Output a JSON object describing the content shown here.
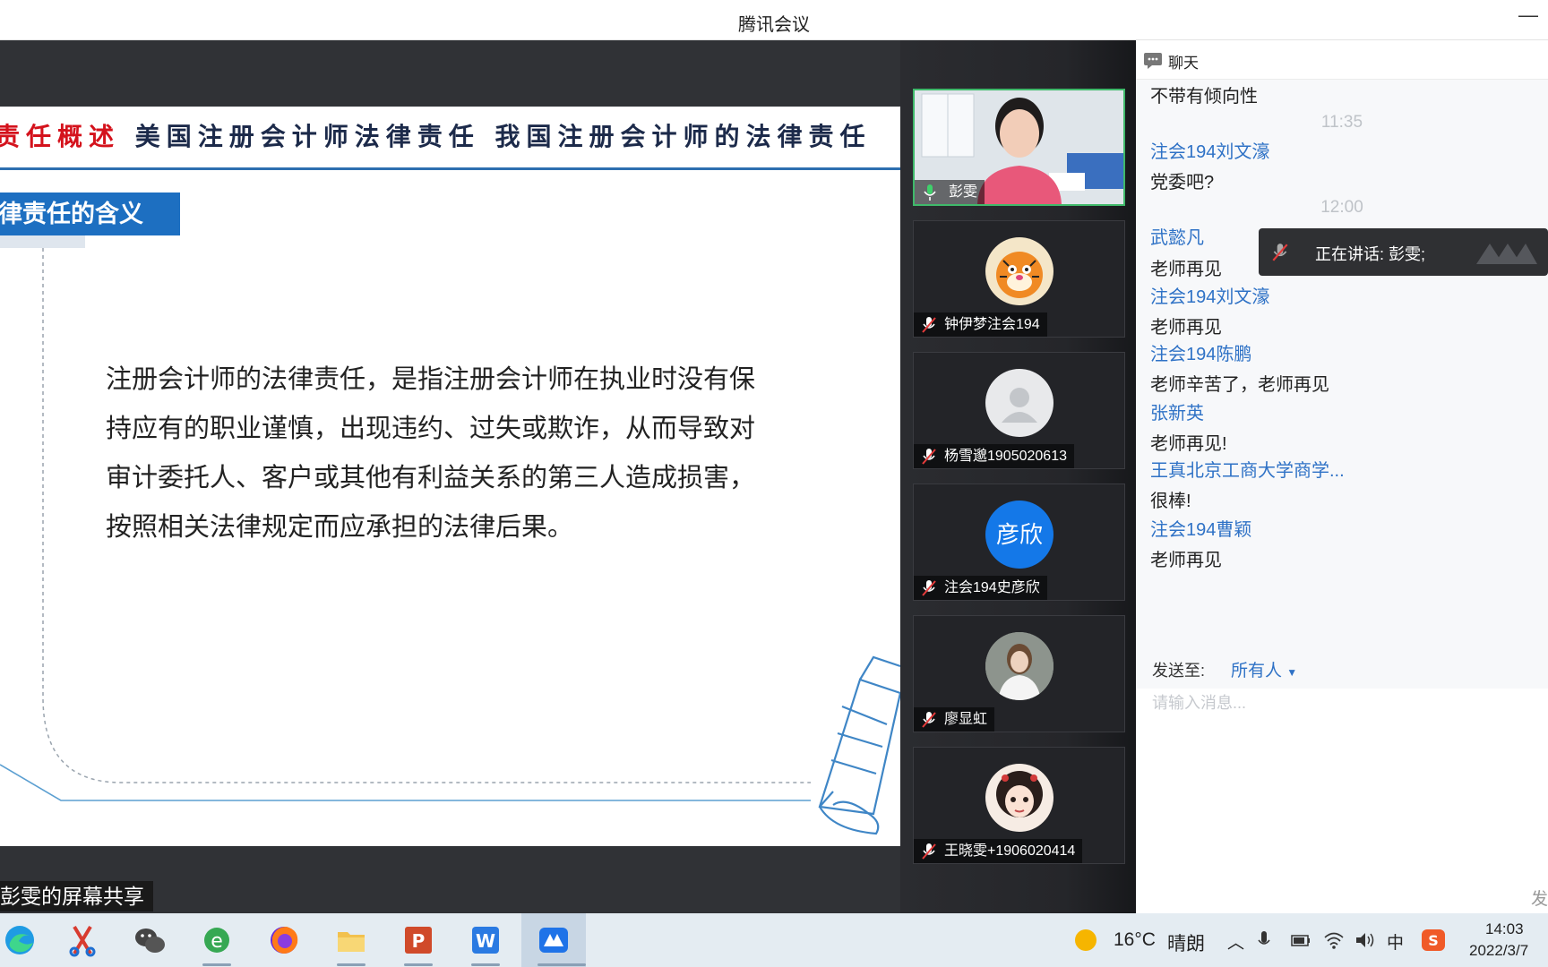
{
  "window": {
    "title": "腾讯会议"
  },
  "slide": {
    "nav_red": "责任概述",
    "nav_rest": "美国注册会计师法律责任 我国注册会计师的法律责任",
    "section_title": "律责任的含义",
    "body_lines": [
      "注册会计师的法律责任，是指注册会计师在执业时没有保",
      "持应有的职业谨慎，出现违约、过失或欺诈，从而导致对",
      "审计委托人、客户或其他有利益关系的第三人造成损害，",
      "按照相关法律规定而应承担的法律后果。"
    ]
  },
  "share_label": "彭雯的屏幕共享",
  "participants": [
    {
      "name": "彭雯",
      "muted": false,
      "avatar": "video",
      "active": true
    },
    {
      "name": "钟伊梦注会194",
      "muted": true,
      "avatar": "tiger"
    },
    {
      "name": "杨雪邈1905020613",
      "muted": true,
      "avatar": "default"
    },
    {
      "name": "注会194史彦欣",
      "muted": true,
      "avatar": "text",
      "avatar_text": "彦欣"
    },
    {
      "name": "廖显虹",
      "muted": true,
      "avatar": "photo"
    },
    {
      "name": "王晓雯+1906020414",
      "muted": true,
      "avatar": "cartoon"
    }
  ],
  "chat": {
    "title": "聊天",
    "messages": [
      {
        "kind": "text",
        "value": "不带有倾向性"
      },
      {
        "kind": "time",
        "value": "11:35"
      },
      {
        "kind": "sender",
        "value": "注会194刘文濠"
      },
      {
        "kind": "text",
        "value": "党委吧?"
      },
      {
        "kind": "time",
        "value": "12:00"
      },
      {
        "kind": "sender",
        "value": "武懿凡"
      },
      {
        "kind": "text",
        "value": "老师再见"
      },
      {
        "kind": "sender",
        "value": "注会194刘文濠"
      },
      {
        "kind": "text",
        "value": "老师再见"
      },
      {
        "kind": "sender",
        "value": "注会194陈鹏"
      },
      {
        "kind": "text",
        "value": "老师辛苦了，老师再见"
      },
      {
        "kind": "sender",
        "value": "张新英"
      },
      {
        "kind": "text",
        "value": "老师再见!"
      },
      {
        "kind": "sender",
        "value": "王真北京工商大学商学..."
      },
      {
        "kind": "text",
        "value": "很棒!"
      },
      {
        "kind": "sender",
        "value": "注会194曹颖"
      },
      {
        "kind": "text",
        "value": "老师再见"
      }
    ],
    "speaking_label": "正在讲话: 彭雯;",
    "send_to_label": "发送至:",
    "send_to_value": "所有人",
    "input_placeholder": "请输入消息...",
    "send_button": "发"
  },
  "taskbar": {
    "apps": [
      "edge-icon",
      "snipping-tool-icon",
      "wechat-icon",
      "ie-browser-icon",
      "firefox-icon",
      "file-explorer-icon",
      "powerpoint-icon",
      "wps-writer-icon",
      "tencent-meeting-icon"
    ],
    "weather_temp": "16°C",
    "weather_text": "晴朗",
    "ime": "中",
    "time": "14:03",
    "date": "2022/3/7"
  },
  "colors": {
    "accent_blue": "#2f72c6",
    "slide_blue": "#1d6fc1",
    "active_green": "#3fb96a",
    "nav_red": "#d4121c"
  }
}
